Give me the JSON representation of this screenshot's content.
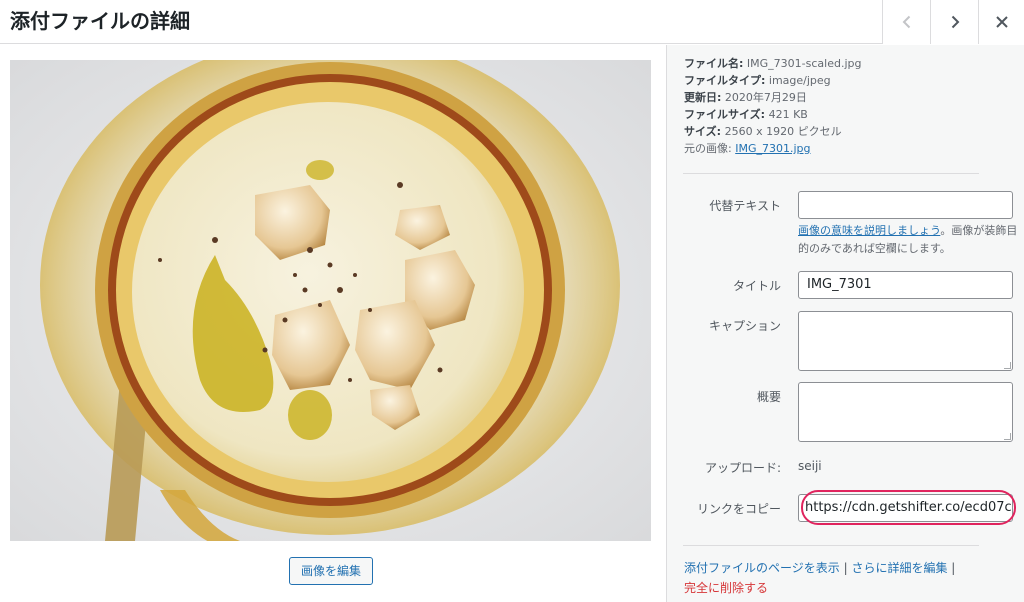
{
  "header": {
    "title": "添付ファイルの詳細",
    "prev_icon": "chevron-left-icon",
    "next_icon": "chevron-right-icon",
    "close_icon": "close-icon"
  },
  "image": {
    "edit_button_label": "画像を編集"
  },
  "details": {
    "filename_label": "ファイル名:",
    "filename_value": "IMG_7301-scaled.jpg",
    "filetype_label": "ファイルタイプ:",
    "filetype_value": "image/jpeg",
    "updated_label": "更新日:",
    "updated_value": "2020年7月29日",
    "filesize_label": "ファイルサイズ:",
    "filesize_value": "421 KB",
    "dimensions_label": "サイズ:",
    "dimensions_value": "2560 x 1920 ピクセル",
    "original_label": "元の画像:",
    "original_link": "IMG_7301.jpg"
  },
  "fields": {
    "alt_label": "代替テキスト",
    "alt_value": "",
    "alt_help_link": "画像の意味を説明しましょう",
    "alt_help_text": "。画像が装飾目的のみであれば空欄にします。",
    "title_label": "タイトル",
    "title_value": "IMG_7301",
    "caption_label": "キャプション",
    "caption_value": "",
    "description_label": "概要",
    "description_value": "",
    "uploader_label": "アップロード:",
    "uploader_value": "seiji",
    "copy_link_label": "リンクをコピー",
    "copy_link_value": "https://cdn.getshifter.co/ecd07c"
  },
  "actions": {
    "view_page": "添付ファイルのページを表示",
    "separator1": " | ",
    "edit_more": "さらに詳細を編集",
    "separator2": " |",
    "delete": "完全に削除する"
  },
  "colors": {
    "link": "#2271b1",
    "danger": "#d63638",
    "highlight": "#e0245e"
  }
}
